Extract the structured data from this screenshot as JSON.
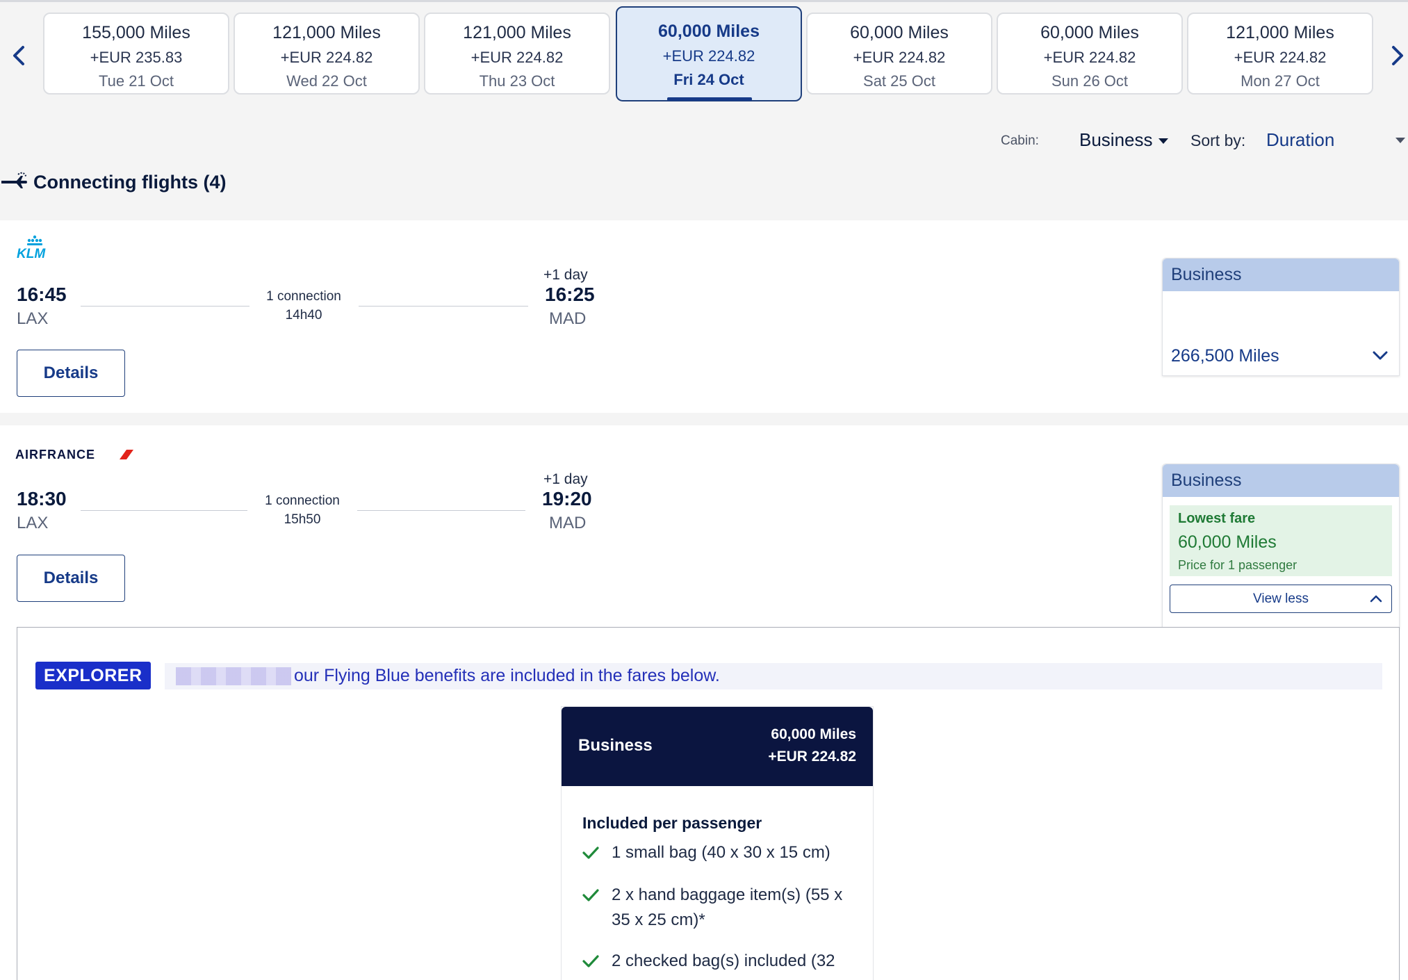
{
  "dates": [
    {
      "miles": "155,000 Miles",
      "eur": "+EUR 235.83",
      "day": "Tue 21 Oct",
      "selected": false
    },
    {
      "miles": "121,000 Miles",
      "eur": "+EUR 224.82",
      "day": "Wed 22 Oct",
      "selected": false
    },
    {
      "miles": "121,000 Miles",
      "eur": "+EUR 224.82",
      "day": "Thu 23 Oct",
      "selected": false
    },
    {
      "miles": "60,000 Miles",
      "eur": "+EUR 224.82",
      "day": "Fri 24 Oct",
      "selected": true
    },
    {
      "miles": "60,000 Miles",
      "eur": "+EUR 224.82",
      "day": "Sat 25 Oct",
      "selected": false
    },
    {
      "miles": "60,000 Miles",
      "eur": "+EUR 224.82",
      "day": "Sun 26 Oct",
      "selected": false
    },
    {
      "miles": "121,000 Miles",
      "eur": "+EUR 224.82",
      "day": "Mon 27 Oct",
      "selected": false
    }
  ],
  "filters": {
    "cabin_label": "Cabin:",
    "cabin_value": "Business",
    "sort_label": "Sort by:",
    "sort_value": "Duration"
  },
  "section": {
    "title": "Connecting flights (4)"
  },
  "flights": [
    {
      "airline": "KLM",
      "dep_time": "16:45",
      "dep_airport": "LAX",
      "connection": "1 connection",
      "duration": "14h40",
      "plus_day": "+1 day",
      "arr_time": "16:25",
      "arr_airport": "MAD",
      "details_label": "Details",
      "fare": {
        "cabin": "Business",
        "miles": "266,500 Miles"
      }
    },
    {
      "airline": "AIRFRANCE",
      "dep_time": "18:30",
      "dep_airport": "LAX",
      "connection": "1 connection",
      "duration": "15h50",
      "plus_day": "+1 day",
      "arr_time": "19:20",
      "arr_airport": "MAD",
      "details_label": "Details",
      "fare": {
        "cabin": "Business",
        "lowest_label": "Lowest fare",
        "miles": "60,000 Miles",
        "passenger": "Price for 1 passenger",
        "view_less": "View less"
      }
    }
  ],
  "expanded": {
    "badge": "EXPLORER",
    "benefits_text": "our Flying Blue benefits are included in the fares below.",
    "fare_name": "Business",
    "fare_miles": "60,000 Miles",
    "fare_eur": "+EUR 224.82",
    "included_title": "Included per passenger",
    "items": [
      "1 small bag (40 x 30 x 15 cm)",
      "2 x hand baggage item(s) (55 x 35 x 25 cm)*",
      "2 checked bag(s) included (32"
    ]
  },
  "colors": {
    "brand_navy": "#0b1540",
    "accent_blue": "#163a88",
    "selected_bg": "#dfeaf8",
    "fare_header": "#b8cbea",
    "green": "#1f7a35",
    "explorer_blue": "#1a2fc9",
    "klm_blue": "#00a1de",
    "af_red": "#e2231a"
  }
}
